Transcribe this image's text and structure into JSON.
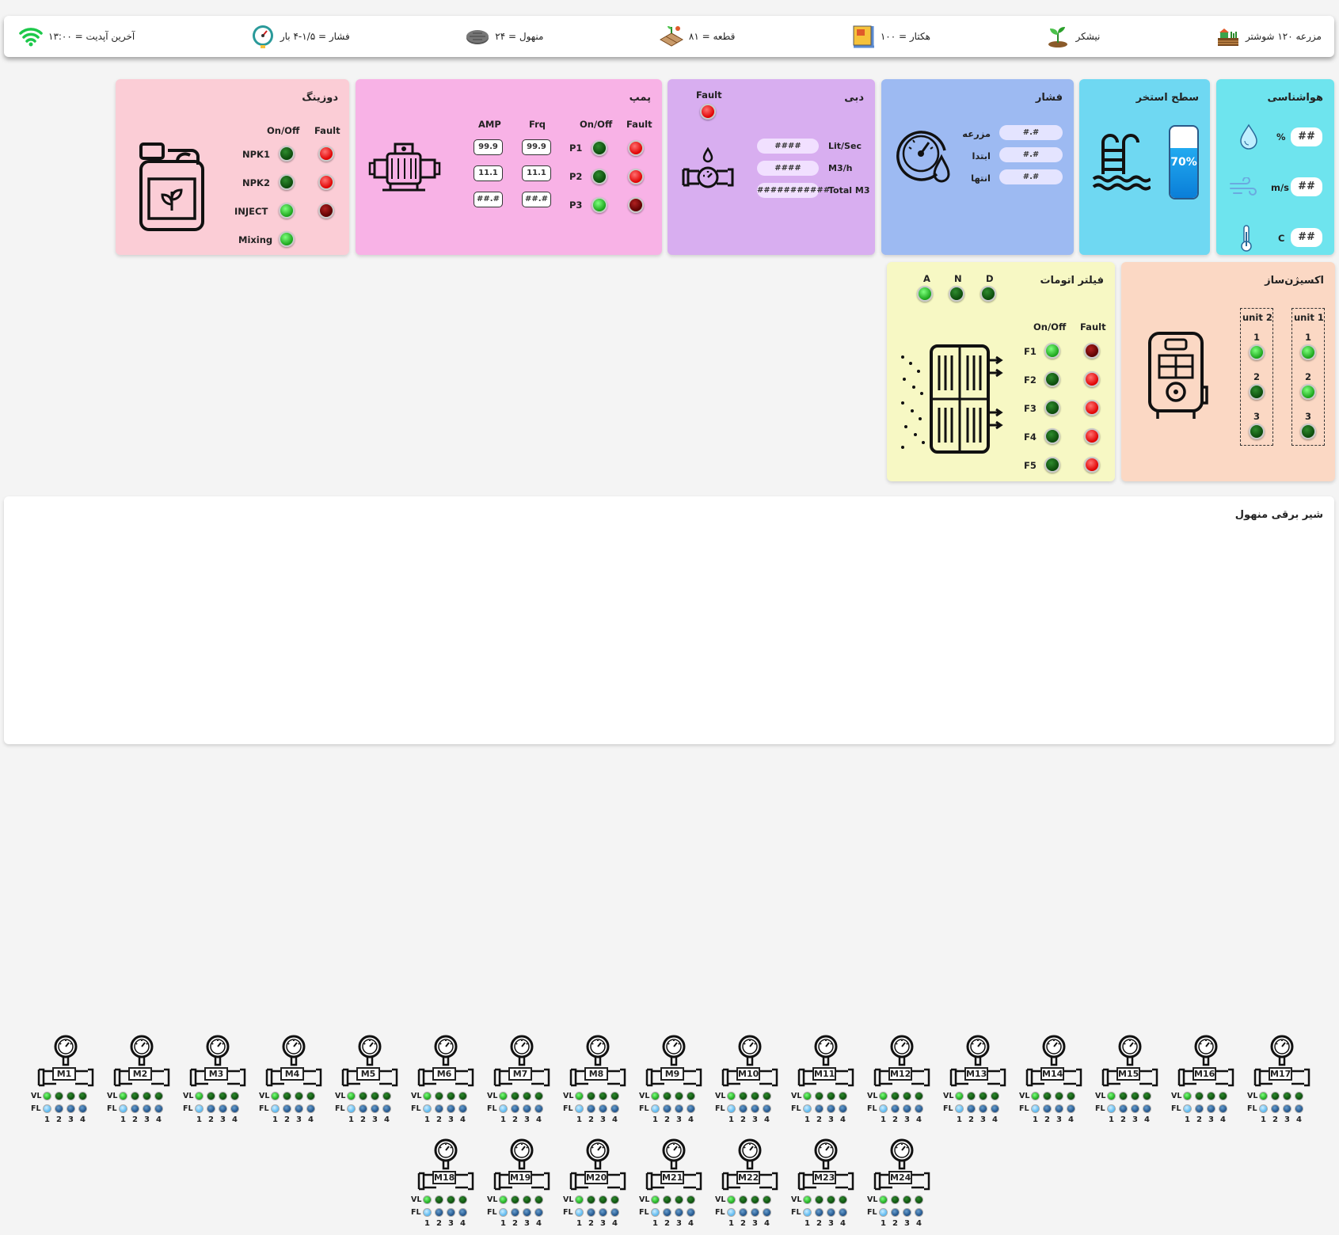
{
  "header": {
    "farm": "مزرعه ۱۲۰ شوشتر",
    "crop": "نیشکر",
    "area": "هکتار = ۱۰۰",
    "block": "قطعه = ۸۱",
    "manifold": "منهول = ۲۴",
    "pressure": "فشار = ۱/۵-۴ بار",
    "update": "آخرین آپدیت = ۱۳:۰۰"
  },
  "weather": {
    "title": "هواشناسی",
    "humidity_unit": "%",
    "humidity": "##",
    "wind_unit": "m/s",
    "wind": "##",
    "temp_unit": "C",
    "temp": "##"
  },
  "pool": {
    "title": "سطح استخر",
    "level": "70%",
    "level_fraction": 0.7
  },
  "pressure_panel": {
    "title": "فشار",
    "rows": [
      {
        "label": "مزرعه",
        "value": "#.#"
      },
      {
        "label": "ابتدا",
        "value": "#.#"
      },
      {
        "label": "انتها",
        "value": "#.#"
      }
    ]
  },
  "flow": {
    "title": "دبی",
    "fault_label": "Fault",
    "rows": [
      {
        "label": "Lit/Sec",
        "value": "####"
      },
      {
        "label": "M3/h",
        "value": "####"
      },
      {
        "label": "Total M3",
        "value": "###########"
      }
    ]
  },
  "pump": {
    "title": "پمپ",
    "col_fault": "Fault",
    "col_onoff": "On/Off",
    "col_frq": "Frq",
    "col_amp": "AMP",
    "rows": [
      {
        "name": "P1",
        "frq": "99.9",
        "amp": "99.9"
      },
      {
        "name": "P2",
        "frq": "11.1",
        "amp": "11.1"
      },
      {
        "name": "P3",
        "frq": "##.#",
        "amp": "##.#"
      }
    ]
  },
  "dosing": {
    "title": "دوزینگ",
    "col_fault": "Fault",
    "col_onoff": "On/Off",
    "rows": [
      {
        "name": "NPK1"
      },
      {
        "name": "NPK2"
      },
      {
        "name": "INJECT"
      },
      {
        "name": "Mixing"
      }
    ]
  },
  "oxygen": {
    "title": "اکسیژن‌ساز",
    "unit1": "unit 1",
    "unit2": "unit 2",
    "n1": "1",
    "n2": "2",
    "n3": "3"
  },
  "filter": {
    "title": "فیلتر اتومات",
    "col_fault": "Fault",
    "col_onoff": "On/Off",
    "a": "A",
    "n": "N",
    "d": "D",
    "rows": [
      "F1",
      "F2",
      "F3",
      "F4",
      "F5"
    ]
  },
  "valves": {
    "title": "شیر برقی منهول",
    "vl": "VL",
    "fl": "FL",
    "n1": "1",
    "n2": "2",
    "n3": "3",
    "n4": "4",
    "names": [
      "M1",
      "M2",
      "M3",
      "M4",
      "M5",
      "M6",
      "M7",
      "M8",
      "M9",
      "M10",
      "M11",
      "M12",
      "M13",
      "M14",
      "M15",
      "M16",
      "M17",
      "M18",
      "M19",
      "M20",
      "M21",
      "M22",
      "M23",
      "M24"
    ]
  },
  "colors": {
    "weather": "#6ee4ee",
    "pool": "#6fd8f2",
    "pressure": "#9dbaf2",
    "flow": "#d8aef0",
    "pump": "#f8b2e6",
    "dosing": "#fbcdd6",
    "oxygen": "#fbd8c4",
    "filter": "#f7f8c4"
  }
}
